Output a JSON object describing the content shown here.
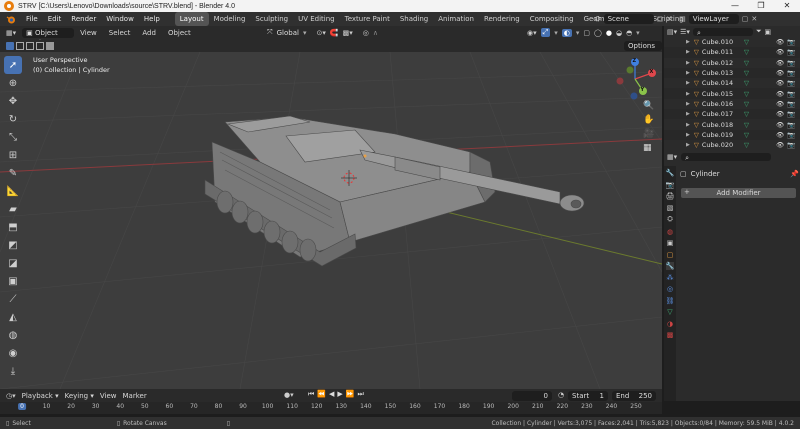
{
  "window": {
    "title": "STRV [C:\\Users\\Lenovo\\Downloads\\source\\STRV.blend] - Blender 4.0",
    "controls": [
      "—",
      "❐",
      "✕"
    ]
  },
  "menu": [
    "File",
    "Edit",
    "Render",
    "Window",
    "Help"
  ],
  "workspaces": [
    "Layout",
    "Modeling",
    "Sculpting",
    "UV Editing",
    "Texture Paint",
    "Shading",
    "Animation",
    "Rendering",
    "Compositing",
    "Geometry Nodes",
    "Scripting"
  ],
  "active_workspace": "Layout",
  "scene": {
    "name": "Scene",
    "view_layer": "ViewLayer"
  },
  "viewport_header": {
    "mode": "Object Mode",
    "menus": [
      "View",
      "Select",
      "Add",
      "Object"
    ],
    "orientation": "Global",
    "options_label": "Options"
  },
  "viewport": {
    "perspective": "User Perspective",
    "collection_info": "(0) Collection | Cylinder",
    "gizmo_axes": {
      "x": "X",
      "y": "Y",
      "z": "Z"
    }
  },
  "outliner": {
    "items": [
      "Cube.010",
      "Cube.011",
      "Cube.012",
      "Cube.013",
      "Cube.014",
      "Cube.015",
      "Cube.016",
      "Cube.017",
      "Cube.018",
      "Cube.019",
      "Cube.020"
    ]
  },
  "properties": {
    "object_name": "Cylinder",
    "add_modifier": "Add Modifier"
  },
  "timeline": {
    "menus": [
      "Playback",
      "Keying",
      "View",
      "Marker"
    ],
    "current_frame": "0",
    "start_label": "Start",
    "start_value": "1",
    "end_label": "End",
    "end_value": "250",
    "ruler": [
      "0",
      "10",
      "20",
      "30",
      "40",
      "50",
      "60",
      "70",
      "80",
      "90",
      "100",
      "110",
      "120",
      "130",
      "140",
      "150",
      "160",
      "170",
      "180",
      "190",
      "200",
      "210",
      "220",
      "230",
      "240",
      "250"
    ]
  },
  "statusbar": {
    "left_hint": "Select",
    "mid_hint": "Rotate Canvas",
    "stats": "Collection | Cylinder | Verts:3,075 | Faces:2,041 | Tris:5,823 | Objects:0/84 | Memory: 59.5 MiB | 4.0.2"
  },
  "colors": {
    "accent": "#4772b3",
    "mesh_icon": "#e8a045",
    "data_icon": "#3fb57a",
    "x_axis": "#e0474c",
    "y_axis": "#8bc34a",
    "z_axis": "#3f7fe0"
  }
}
